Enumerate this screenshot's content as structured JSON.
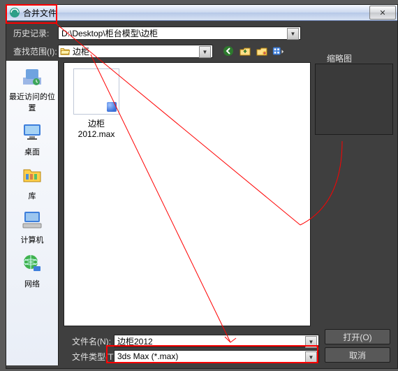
{
  "window": {
    "title": "合并文件",
    "close_glyph": "✕"
  },
  "history": {
    "label": "历史记录:",
    "path": "D:\\Desktop\\柜台模型\\边柜"
  },
  "lookin": {
    "label": "查找范围(I):",
    "folder": "边柜"
  },
  "thumbnail_heading": "缩略图",
  "sidebar": {
    "items": [
      {
        "label": "最近访问的位置"
      },
      {
        "label": "桌面"
      },
      {
        "label": "库"
      },
      {
        "label": "计算机"
      },
      {
        "label": "网络"
      }
    ]
  },
  "files": [
    {
      "name": "边柜2012.max"
    }
  ],
  "filename_row": {
    "label": "文件名(N):",
    "value": "边柜2012"
  },
  "filetype_row": {
    "label": "文件类型(T):",
    "value": "3ds Max (*.max)"
  },
  "buttons": {
    "open": "打开(O)",
    "cancel": "取消"
  }
}
